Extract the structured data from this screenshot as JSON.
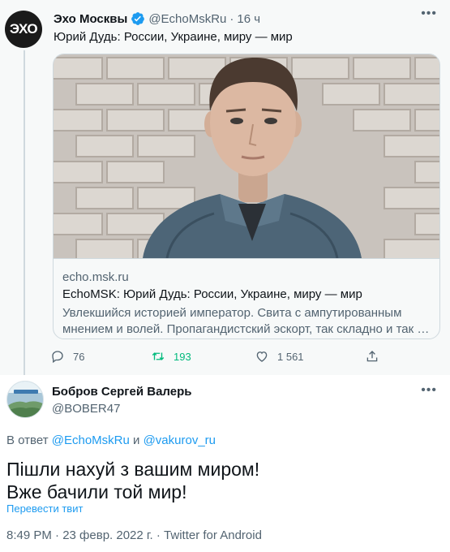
{
  "parent_tweet": {
    "author_name": "Эхо Москвы",
    "author_handle": "@EchoMskRu",
    "separator": "·",
    "time": "16 ч",
    "avatar_text": "ЭХО",
    "text": "Юрий Дудь: России, Украине, миру — мир",
    "more_icon": "more-icon",
    "card": {
      "domain": "echo.msk.ru",
      "title": "EchoMSK: Юрий Дудь: России, Украине, миру — мир",
      "description": "Увлекшийся историей император. Свита с ампутированным мнением и волей. Пропагандистский эскорт, так складно и так …"
    },
    "actions": {
      "replies": "76",
      "retweets": "193",
      "likes": "1 561"
    },
    "colors": {
      "retweet_active": "#00ba7c",
      "verified": "#1d9bf0"
    }
  },
  "reply_tweet": {
    "author_name": "Бобров Сергей Валерь",
    "author_handle": "@BOBER47",
    "reply_prefix": "В ответ",
    "reply_to_1": "@EchoMskRu",
    "reply_and": "и",
    "reply_to_2": "@vakurov_ru",
    "text_line_1": "Пішли нахуй з вашим миром!",
    "text_line_2": "Вже бачили той мир!",
    "translate_label": "Перевести твит",
    "meta": "8:49 PM · 23 февр. 2022 г. · Twitter for Android",
    "colors": {
      "link": "#1d9bf0"
    }
  }
}
